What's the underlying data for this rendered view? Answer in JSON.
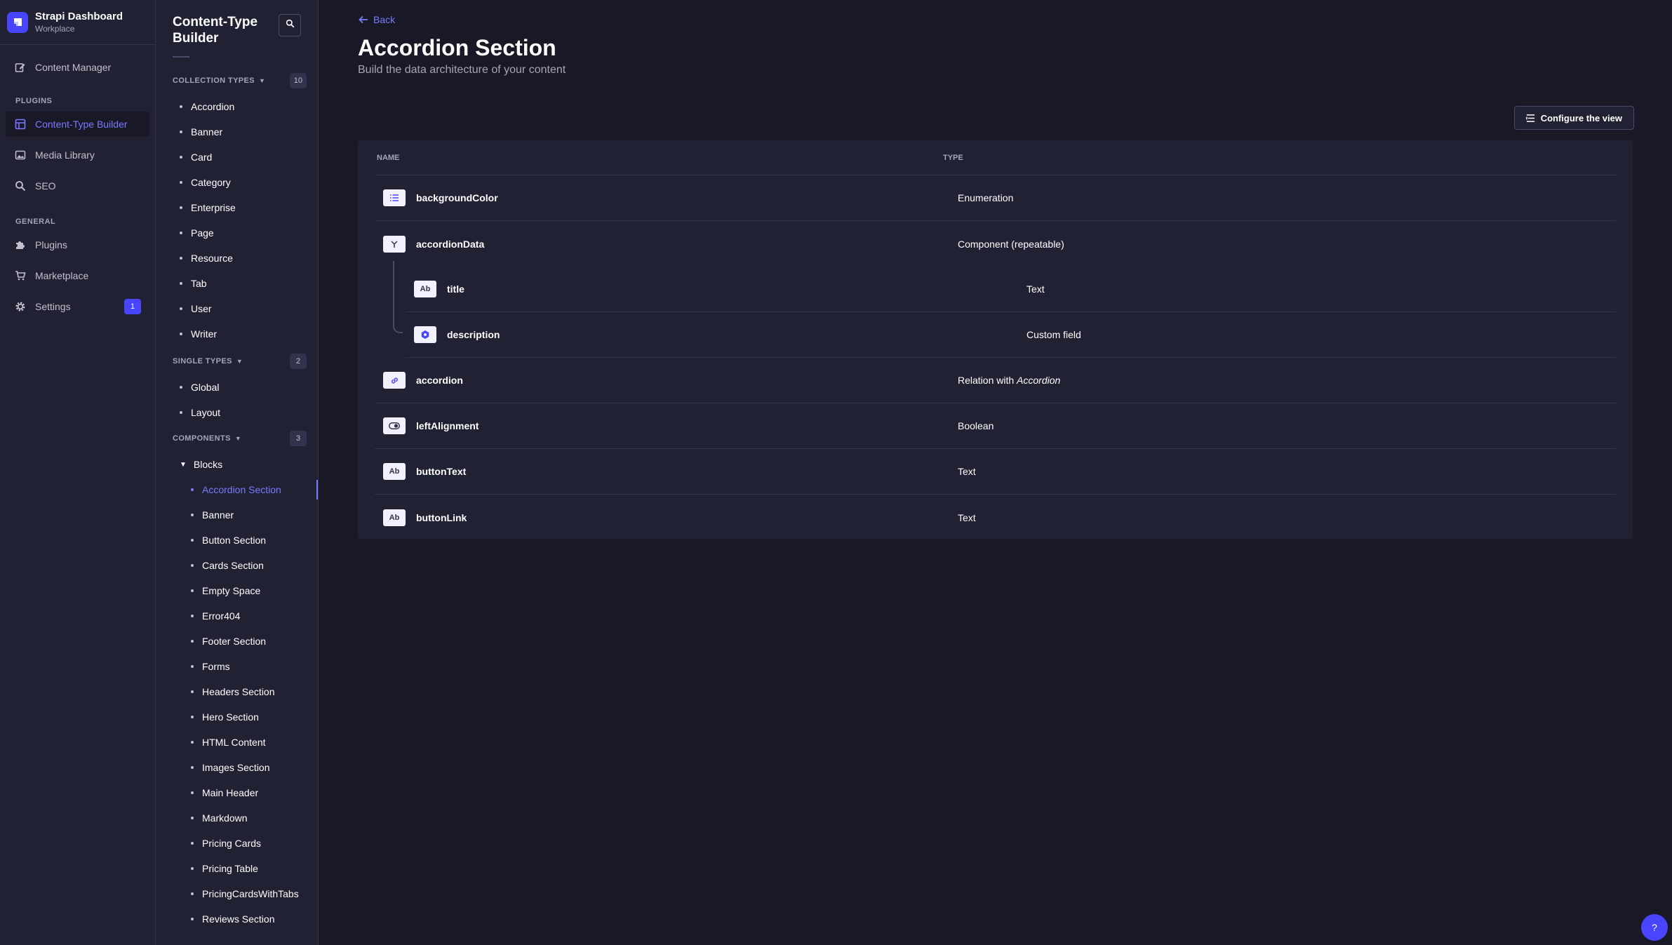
{
  "brand": {
    "title": "Strapi Dashboard",
    "subtitle": "Workplace"
  },
  "mainnav": {
    "content_manager": "Content Manager",
    "plugins_section": "PLUGINS",
    "plugins_items": [
      "Content-Type Builder",
      "Media Library",
      "SEO"
    ],
    "general_section": "GENERAL",
    "general_items": [
      "Plugins",
      "Marketplace",
      "Settings"
    ],
    "settings_badge": "1"
  },
  "subnav": {
    "title": "Content-Type Builder",
    "collection_types": {
      "label": "COLLECTION TYPES",
      "count": "10",
      "items": [
        "Accordion",
        "Banner",
        "Card",
        "Category",
        "Enterprise",
        "Page",
        "Resource",
        "Tab",
        "User",
        "Writer"
      ]
    },
    "single_types": {
      "label": "SINGLE TYPES",
      "count": "2",
      "items": [
        "Global",
        "Layout"
      ]
    },
    "components": {
      "label": "COMPONENTS",
      "count": "3",
      "category": "Blocks",
      "items": [
        "Accordion Section",
        "Banner",
        "Button Section",
        "Cards Section",
        "Empty Space",
        "Error404",
        "Footer Section",
        "Forms",
        "Headers Section",
        "Hero Section",
        "HTML Content",
        "Images Section",
        "Main Header",
        "Markdown",
        "Pricing Cards",
        "Pricing Table",
        "PricingCardsWithTabs",
        "Reviews Section"
      ]
    }
  },
  "main": {
    "back": "Back",
    "title": "Accordion Section",
    "subtitle": "Build the data architecture of your content",
    "configure": "Configure the view",
    "table": {
      "col_name": "NAME",
      "col_type": "TYPE",
      "rows": [
        {
          "icon": "enumeration-icon",
          "name": "backgroundColor",
          "type": "Enumeration"
        },
        {
          "icon": "component-icon",
          "name": "accordionData",
          "type": "Component (repeatable)"
        },
        {
          "icon": "text-icon",
          "icon_text": "Ab",
          "name": "title",
          "type": "Text"
        },
        {
          "icon": "custom-field-icon",
          "name": "description",
          "type": "Custom field"
        },
        {
          "icon": "relation-icon",
          "name": "accordion",
          "type_prefix": "Relation with",
          "type_target": "Accordion"
        },
        {
          "icon": "boolean-icon",
          "name": "leftAlignment",
          "type": "Boolean"
        },
        {
          "icon": "text-icon",
          "icon_text": "Ab",
          "name": "buttonText",
          "type": "Text"
        },
        {
          "icon": "text-icon",
          "icon_text": "Ab",
          "name": "buttonLink",
          "type": "Text"
        }
      ]
    },
    "help": "?"
  },
  "colors": {
    "accent": "#7b79ff",
    "primary": "#4945ff",
    "background": "#181826",
    "surface": "#212134"
  }
}
